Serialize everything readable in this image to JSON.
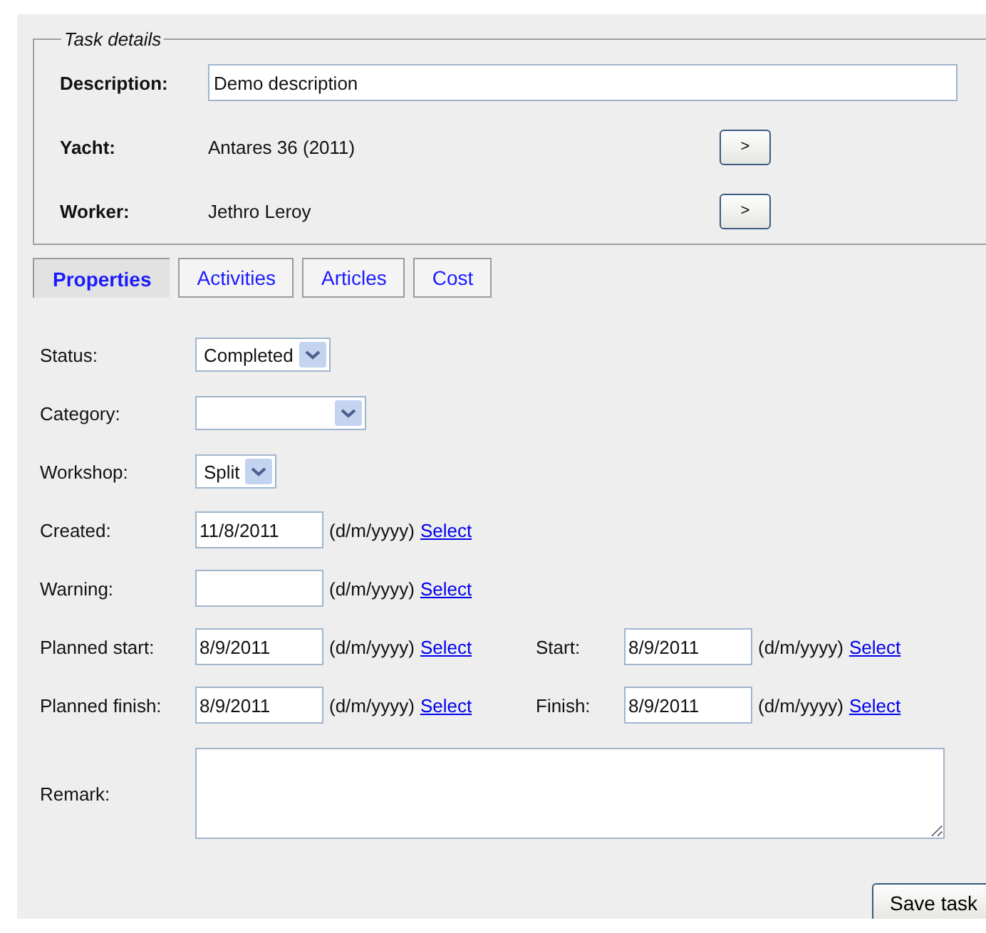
{
  "task_details": {
    "legend": "Task details",
    "rows": [
      {
        "kind": "input",
        "label": "Description:",
        "value": "Demo description"
      },
      {
        "kind": "lookup",
        "label": "Yacht:",
        "value": "Antares 36 (2011)",
        "button": ">"
      },
      {
        "kind": "lookup",
        "label": "Worker:",
        "value": "Jethro Leroy",
        "button": ">"
      }
    ]
  },
  "tabs": [
    {
      "label": "Properties",
      "selected": true
    },
    {
      "label": "Activities",
      "selected": false
    },
    {
      "label": "Articles",
      "selected": false
    },
    {
      "label": "Cost",
      "selected": false
    }
  ],
  "properties": {
    "rows": [
      {
        "kind": "select",
        "label": "Status:",
        "value": "Completed"
      },
      {
        "kind": "select",
        "label": "Category:"
      },
      {
        "kind": "select",
        "label": "Workshop:",
        "value": "Split"
      },
      {
        "kind": "dates",
        "fields": [
          {
            "label": "Created:",
            "value": "11/8/2011",
            "format": "(d/m/yyyy)",
            "link": "Select"
          }
        ]
      },
      {
        "kind": "dates",
        "fields": [
          {
            "label": "Warning:",
            "format": "(d/m/yyyy)",
            "link": "Select"
          }
        ]
      },
      {
        "kind": "dates",
        "fields": [
          {
            "label": "Planned start:",
            "value": "8/9/2011",
            "format": "(d/m/yyyy)",
            "link": "Select"
          },
          {
            "label": "Start:",
            "value": "8/9/2011",
            "format": "(d/m/yyyy)",
            "link": "Select"
          }
        ]
      },
      {
        "kind": "dates",
        "fields": [
          {
            "label": "Planned finish:",
            "value": "8/9/2011",
            "format": "(d/m/yyyy)",
            "link": "Select"
          },
          {
            "label": "Finish:",
            "value": "8/9/2011",
            "format": "(d/m/yyyy)",
            "link": "Select"
          }
        ]
      },
      {
        "kind": "textarea",
        "label": "Remark:"
      }
    ]
  },
  "save_button": "Save task"
}
